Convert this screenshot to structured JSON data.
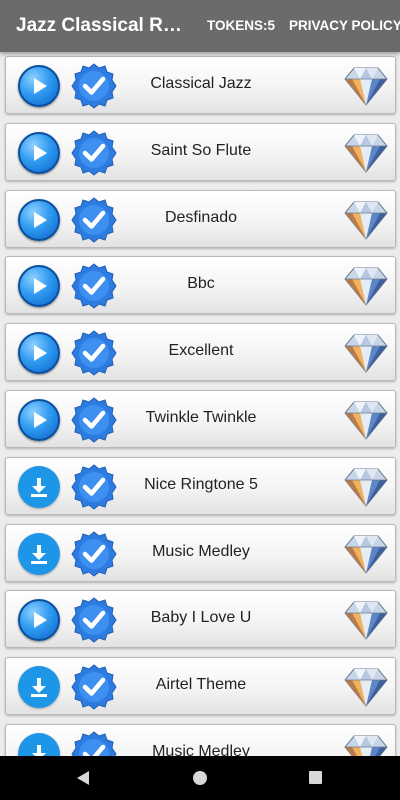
{
  "appbar": {
    "title": "Jazz Classical Rin…",
    "tokens_label": "TOKENS:5",
    "privacy_label": "PRIVACY POLICY"
  },
  "colors": {
    "appbar": "#6b6b6b",
    "play_blue": "#1e88e5",
    "download_blue": "#1e96e8",
    "check_blue": "#2d7be0"
  },
  "ringtones": [
    {
      "title": "Classical Jazz",
      "action_icon": "play-icon"
    },
    {
      "title": "Saint So Flute",
      "action_icon": "play-icon"
    },
    {
      "title": "Desfinado",
      "action_icon": "play-icon"
    },
    {
      "title": "Bbc",
      "action_icon": "play-icon"
    },
    {
      "title": "Excellent",
      "action_icon": "play-icon"
    },
    {
      "title": "Twinkle Twinkle",
      "action_icon": "play-icon"
    },
    {
      "title": "Nice Ringtone 5",
      "action_icon": "download-icon"
    },
    {
      "title": "Music Medley",
      "action_icon": "download-icon"
    },
    {
      "title": "Baby I Love U",
      "action_icon": "play-icon"
    },
    {
      "title": "Airtel Theme",
      "action_icon": "download-icon"
    },
    {
      "title": "Music Medley",
      "action_icon": "download-icon"
    }
  ],
  "row_icons": {
    "selected": "checkmark-badge-icon",
    "premium": "diamond-icon"
  },
  "navbar": {
    "back": "back-triangle-icon",
    "home": "home-circle-icon",
    "recents": "recents-square-icon"
  }
}
